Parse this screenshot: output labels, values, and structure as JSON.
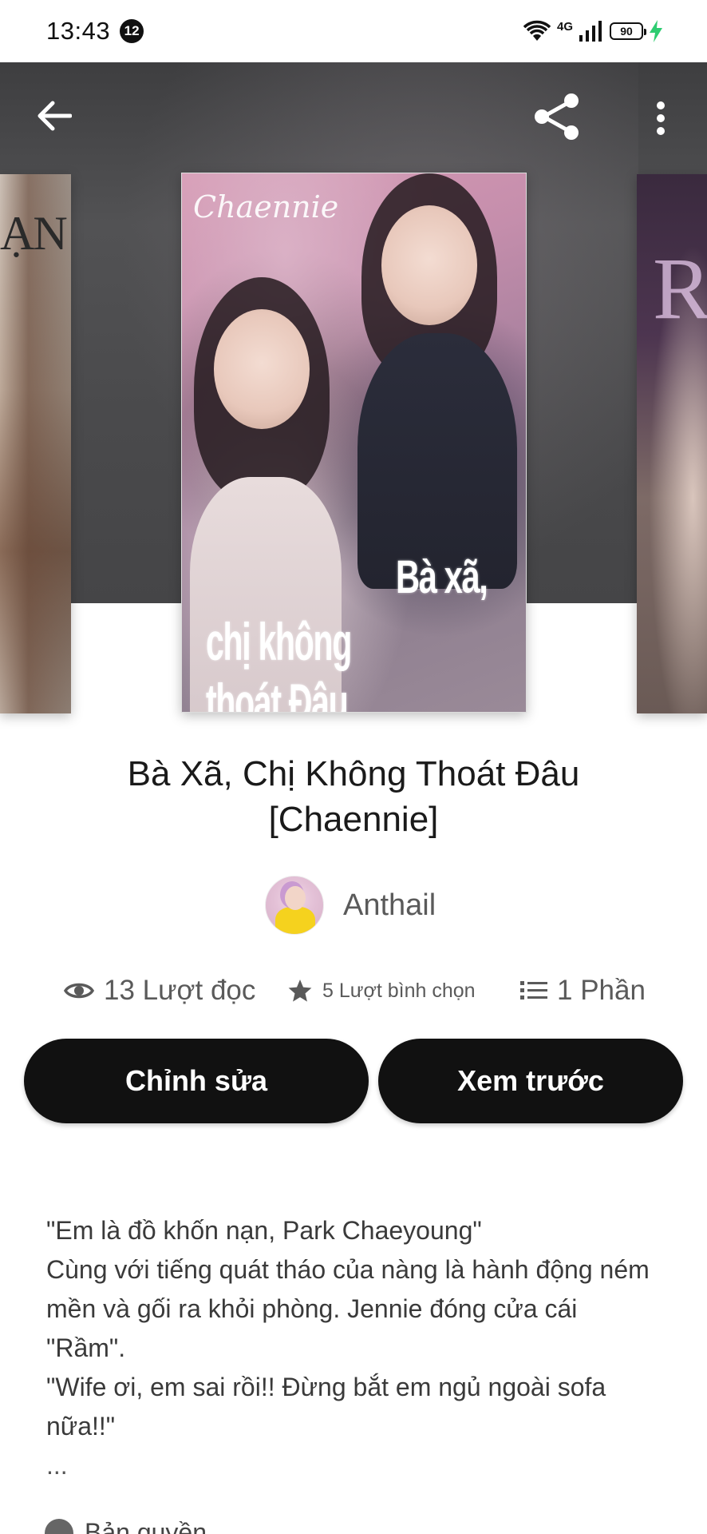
{
  "status_bar": {
    "time": "13:43",
    "notification_count": "12",
    "network": "4G",
    "battery": "90",
    "charging_color": "#2ecc71"
  },
  "hero": {
    "left_cover_text": "ẠN",
    "right_cover_text": "R",
    "main_cover": {
      "script_text": "Chaennie",
      "title_line1": "Bà xã,",
      "title_line2": "chị không thoát Đâu"
    }
  },
  "toolbar": {
    "back_icon": "arrow-left-icon",
    "share_icon": "share-icon",
    "more_icon": "more-vertical-icon"
  },
  "book": {
    "title": "Bà Xã, Chị Không Thoát Đâu [Chaennie]",
    "author": "Anthail"
  },
  "stats": {
    "reads": "13 Lượt đọc",
    "votes": "5 Lượt bình chọn",
    "parts": "1 Phần"
  },
  "actions": {
    "edit_label": "Chỉnh sửa",
    "preview_label": "Xem trước"
  },
  "description": {
    "lines": [
      "\"Em là đồ khốn nạn, Park Chaeyoung\"",
      "Cùng với tiếng quát tháo của nàng là hành động ném mền và gối ra khỏi phòng. Jennie đóng cửa cái \"Rầm\".",
      "\"Wife ơi, em sai rồi!! Đừng bắt em ngủ ngoài sofa nữa!!\""
    ],
    "ellipsis": "..."
  },
  "bottom_peek": {
    "text": "Bản quyền"
  },
  "colors": {
    "button_bg": "#111111",
    "button_text": "#ffffff",
    "muted_text": "#5a5a5a"
  }
}
